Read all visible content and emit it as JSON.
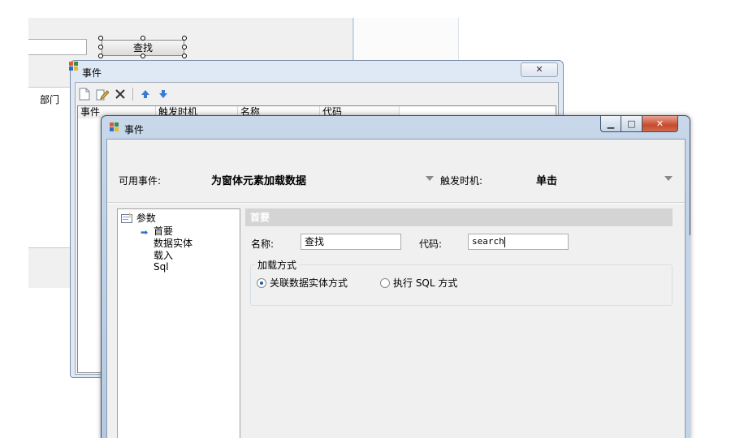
{
  "designer": {
    "find_button": "查找",
    "dept_header": "部门"
  },
  "back_window": {
    "title": "事件",
    "toolbar": {
      "new_icon": "new-document-icon",
      "edit_icon": "edit-icon",
      "delete_icon": "delete-x-icon",
      "up_icon": "move-up-icon",
      "down_icon": "move-down-icon"
    },
    "columns": [
      "事件",
      "触发时机",
      "名称",
      "代码"
    ]
  },
  "front_window": {
    "title": "事件",
    "available_events_label": "可用事件:",
    "available_events_value": "为窗体元素加载数据",
    "trigger_label": "触发时机:",
    "trigger_value": "单击",
    "tree": {
      "root": "参数",
      "items": [
        "首要",
        "数据实体",
        "载入",
        "Sql"
      ]
    },
    "panel_title": "首要",
    "name_label": "名称:",
    "name_value": "查找",
    "code_label": "代码:",
    "code_value": "search",
    "load_mode": {
      "title": "加载方式",
      "options": [
        {
          "label": "关联数据实体方式",
          "selected": true
        },
        {
          "label": "执行 SQL 方式",
          "selected": false
        }
      ]
    }
  }
}
